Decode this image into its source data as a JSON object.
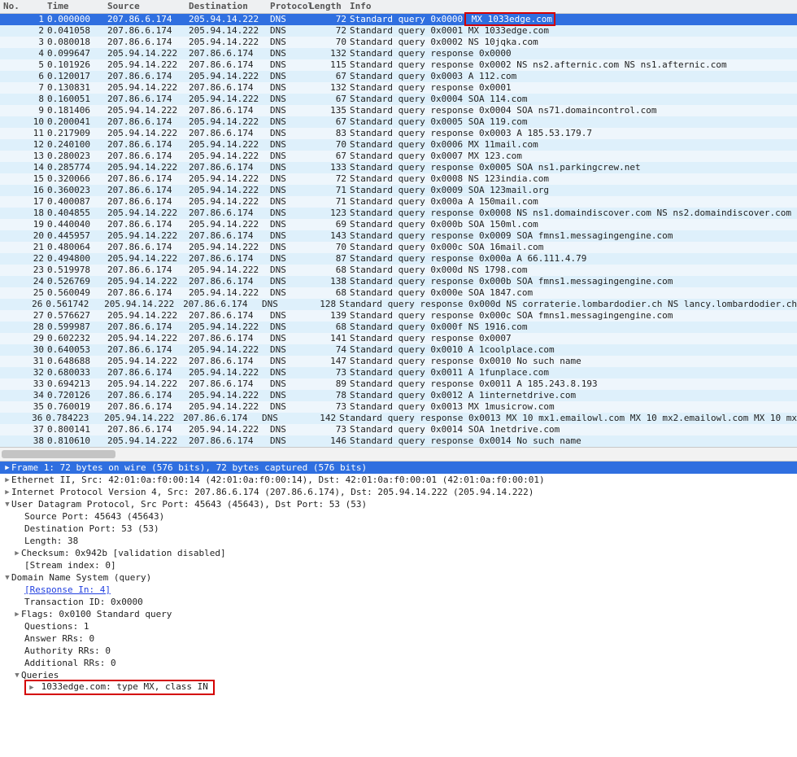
{
  "columns": {
    "no": "No.",
    "time": "Time",
    "src": "Source",
    "dst": "Destination",
    "proto": "Protocol",
    "len": "Length",
    "info": "Info"
  },
  "packets": [
    {
      "no": 1,
      "time": "0.000000",
      "src": "207.86.6.174",
      "dst": "205.94.14.222",
      "proto": "DNS",
      "len": 72,
      "info": "Standard query 0x0000",
      "hl": "MX 1033edge.com"
    },
    {
      "no": 2,
      "time": "0.041058",
      "src": "207.86.6.174",
      "dst": "205.94.14.222",
      "proto": "DNS",
      "len": 72,
      "info": "Standard query 0x0001  MX 1033edge.com"
    },
    {
      "no": 3,
      "time": "0.080018",
      "src": "207.86.6.174",
      "dst": "205.94.14.222",
      "proto": "DNS",
      "len": 70,
      "info": "Standard query 0x0002  NS 10jqka.com"
    },
    {
      "no": 4,
      "time": "0.099647",
      "src": "205.94.14.222",
      "dst": "207.86.6.174",
      "proto": "DNS",
      "len": 132,
      "info": "Standard query response 0x0000"
    },
    {
      "no": 5,
      "time": "0.101926",
      "src": "205.94.14.222",
      "dst": "207.86.6.174",
      "proto": "DNS",
      "len": 115,
      "info": "Standard query response 0x0002  NS ns2.afternic.com NS ns1.afternic.com"
    },
    {
      "no": 6,
      "time": "0.120017",
      "src": "207.86.6.174",
      "dst": "205.94.14.222",
      "proto": "DNS",
      "len": 67,
      "info": "Standard query 0x0003  A 112.com"
    },
    {
      "no": 7,
      "time": "0.130831",
      "src": "205.94.14.222",
      "dst": "207.86.6.174",
      "proto": "DNS",
      "len": 132,
      "info": "Standard query response 0x0001"
    },
    {
      "no": 8,
      "time": "0.160051",
      "src": "207.86.6.174",
      "dst": "205.94.14.222",
      "proto": "DNS",
      "len": 67,
      "info": "Standard query 0x0004  SOA 114.com"
    },
    {
      "no": 9,
      "time": "0.181406",
      "src": "205.94.14.222",
      "dst": "207.86.6.174",
      "proto": "DNS",
      "len": 135,
      "info": "Standard query response 0x0004  SOA ns71.domaincontrol.com"
    },
    {
      "no": 10,
      "time": "0.200041",
      "src": "207.86.6.174",
      "dst": "205.94.14.222",
      "proto": "DNS",
      "len": 67,
      "info": "Standard query 0x0005  SOA 119.com"
    },
    {
      "no": 11,
      "time": "0.217909",
      "src": "205.94.14.222",
      "dst": "207.86.6.174",
      "proto": "DNS",
      "len": 83,
      "info": "Standard query response 0x0003  A 185.53.179.7"
    },
    {
      "no": 12,
      "time": "0.240100",
      "src": "207.86.6.174",
      "dst": "205.94.14.222",
      "proto": "DNS",
      "len": 70,
      "info": "Standard query 0x0006  MX 11mail.com"
    },
    {
      "no": 13,
      "time": "0.280023",
      "src": "207.86.6.174",
      "dst": "205.94.14.222",
      "proto": "DNS",
      "len": 67,
      "info": "Standard query 0x0007  MX 123.com"
    },
    {
      "no": 14,
      "time": "0.285774",
      "src": "205.94.14.222",
      "dst": "207.86.6.174",
      "proto": "DNS",
      "len": 133,
      "info": "Standard query response 0x0005  SOA ns1.parkingcrew.net"
    },
    {
      "no": 15,
      "time": "0.320066",
      "src": "207.86.6.174",
      "dst": "205.94.14.222",
      "proto": "DNS",
      "len": 72,
      "info": "Standard query 0x0008  NS 123india.com"
    },
    {
      "no": 16,
      "time": "0.360023",
      "src": "207.86.6.174",
      "dst": "205.94.14.222",
      "proto": "DNS",
      "len": 71,
      "info": "Standard query 0x0009  SOA 123mail.org"
    },
    {
      "no": 17,
      "time": "0.400087",
      "src": "207.86.6.174",
      "dst": "205.94.14.222",
      "proto": "DNS",
      "len": 71,
      "info": "Standard query 0x000a  A 150mail.com"
    },
    {
      "no": 18,
      "time": "0.404855",
      "src": "205.94.14.222",
      "dst": "207.86.6.174",
      "proto": "DNS",
      "len": 123,
      "info": "Standard query response 0x0008  NS ns1.domaindiscover.com NS ns2.domaindiscover.com"
    },
    {
      "no": 19,
      "time": "0.440040",
      "src": "207.86.6.174",
      "dst": "205.94.14.222",
      "proto": "DNS",
      "len": 69,
      "info": "Standard query 0x000b  SOA 150ml.com"
    },
    {
      "no": 20,
      "time": "0.445957",
      "src": "205.94.14.222",
      "dst": "207.86.6.174",
      "proto": "DNS",
      "len": 143,
      "info": "Standard query response 0x0009  SOA fmns1.messagingengine.com"
    },
    {
      "no": 21,
      "time": "0.480064",
      "src": "207.86.6.174",
      "dst": "205.94.14.222",
      "proto": "DNS",
      "len": 70,
      "info": "Standard query 0x000c  SOA 16mail.com"
    },
    {
      "no": 22,
      "time": "0.494800",
      "src": "205.94.14.222",
      "dst": "207.86.6.174",
      "proto": "DNS",
      "len": 87,
      "info": "Standard query response 0x000a  A 66.111.4.79"
    },
    {
      "no": 23,
      "time": "0.519978",
      "src": "207.86.6.174",
      "dst": "205.94.14.222",
      "proto": "DNS",
      "len": 68,
      "info": "Standard query 0x000d  NS 1798.com"
    },
    {
      "no": 24,
      "time": "0.526769",
      "src": "205.94.14.222",
      "dst": "207.86.6.174",
      "proto": "DNS",
      "len": 138,
      "info": "Standard query response 0x000b  SOA fmns1.messagingengine.com"
    },
    {
      "no": 25,
      "time": "0.560049",
      "src": "207.86.6.174",
      "dst": "205.94.14.222",
      "proto": "DNS",
      "len": 68,
      "info": "Standard query 0x000e  SOA 1847.com"
    },
    {
      "no": 26,
      "time": "0.561742",
      "src": "205.94.14.222",
      "dst": "207.86.6.174",
      "proto": "DNS",
      "len": 128,
      "info": "Standard query response 0x000d  NS corraterie.lombardodier.ch NS lancy.lombardodier.ch"
    },
    {
      "no": 27,
      "time": "0.576627",
      "src": "205.94.14.222",
      "dst": "207.86.6.174",
      "proto": "DNS",
      "len": 139,
      "info": "Standard query response 0x000c  SOA fmns1.messagingengine.com"
    },
    {
      "no": 28,
      "time": "0.599987",
      "src": "207.86.6.174",
      "dst": "205.94.14.222",
      "proto": "DNS",
      "len": 68,
      "info": "Standard query 0x000f  NS 1916.com"
    },
    {
      "no": 29,
      "time": "0.602232",
      "src": "205.94.14.222",
      "dst": "207.86.6.174",
      "proto": "DNS",
      "len": 141,
      "info": "Standard query response 0x0007"
    },
    {
      "no": 30,
      "time": "0.640053",
      "src": "207.86.6.174",
      "dst": "205.94.14.222",
      "proto": "DNS",
      "len": 74,
      "info": "Standard query 0x0010  A 1coolplace.com"
    },
    {
      "no": 31,
      "time": "0.648688",
      "src": "205.94.14.222",
      "dst": "207.86.6.174",
      "proto": "DNS",
      "len": 147,
      "info": "Standard query response 0x0010 No such name"
    },
    {
      "no": 32,
      "time": "0.680033",
      "src": "207.86.6.174",
      "dst": "205.94.14.222",
      "proto": "DNS",
      "len": 73,
      "info": "Standard query 0x0011  A 1funplace.com"
    },
    {
      "no": 33,
      "time": "0.694213",
      "src": "205.94.14.222",
      "dst": "207.86.6.174",
      "proto": "DNS",
      "len": 89,
      "info": "Standard query response 0x0011  A 185.243.8.193"
    },
    {
      "no": 34,
      "time": "0.720126",
      "src": "207.86.6.174",
      "dst": "205.94.14.222",
      "proto": "DNS",
      "len": 78,
      "info": "Standard query 0x0012  A 1internetdrive.com"
    },
    {
      "no": 35,
      "time": "0.760019",
      "src": "207.86.6.174",
      "dst": "205.94.14.222",
      "proto": "DNS",
      "len": 73,
      "info": "Standard query 0x0013  MX 1musicrow.com"
    },
    {
      "no": 36,
      "time": "0.784223",
      "src": "205.94.14.222",
      "dst": "207.86.6.174",
      "proto": "DNS",
      "len": 142,
      "info": "Standard query response 0x0013  MX 10 mx1.emailowl.com MX 10 mx2.emailowl.com MX 10 mx"
    },
    {
      "no": 37,
      "time": "0.800141",
      "src": "207.86.6.174",
      "dst": "205.94.14.222",
      "proto": "DNS",
      "len": 73,
      "info": "Standard query 0x0014  SOA 1netdrive.com"
    },
    {
      "no": 38,
      "time": "0.810610",
      "src": "205.94.14.222",
      "dst": "207.86.6.174",
      "proto": "DNS",
      "len": 146,
      "info": "Standard query response 0x0014 No such name"
    }
  ],
  "detail": {
    "frame": "Frame 1: 72 bytes on wire (576 bits), 72 bytes captured (576 bits)",
    "eth": "Ethernet II, Src: 42:01:0a:f0:00:14 (42:01:0a:f0:00:14), Dst: 42:01:0a:f0:00:01 (42:01:0a:f0:00:01)",
    "ip": "Internet Protocol Version 4, Src: 207.86.6.174 (207.86.6.174), Dst: 205.94.14.222 (205.94.14.222)",
    "udp": "User Datagram Protocol, Src Port: 45643 (45643), Dst Port: 53 (53)",
    "udp_children": {
      "srcport": "Source Port: 45643 (45643)",
      "dstport": "Destination Port: 53 (53)",
      "length": "Length: 38",
      "chksum": "Checksum: 0x942b [validation disabled]",
      "stream": "[Stream index: 0]"
    },
    "dns_header": "Domain Name System (query)",
    "dns_children": {
      "resp_in": "[Response In: 4]",
      "txid": "Transaction ID: 0x0000",
      "flags": "Flags: 0x0100 Standard query",
      "questions": "Questions: 1",
      "answers": "Answer RRs: 0",
      "authority": "Authority RRs: 0",
      "additional": "Additional RRs: 0",
      "queries": "Queries",
      "query_line": "1033edge.com: type MX, class IN"
    }
  }
}
